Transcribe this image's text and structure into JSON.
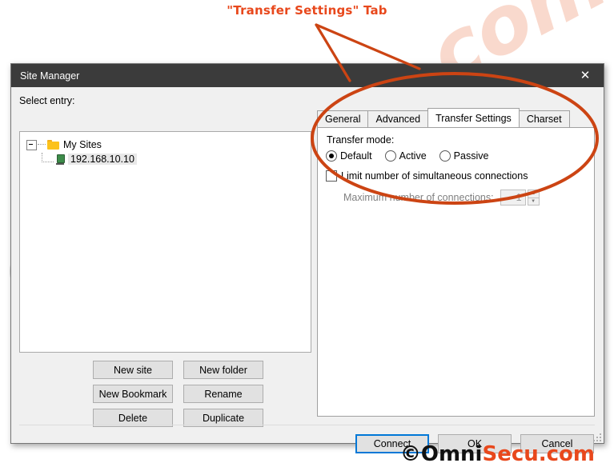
{
  "annotation": {
    "callout_text": "\"Transfer Settings\" Tab",
    "callout_color": "#e8481c",
    "ellipse_color": "#cc4413"
  },
  "watermark": {
    "part_gray": "Omni",
    "part_orange": "Secu.com"
  },
  "dialog": {
    "title": "Site Manager",
    "close_icon": "close-icon",
    "select_entry_label": "Select entry:",
    "tree": {
      "root": {
        "label": "My Sites",
        "icon": "folder-icon",
        "expander": "collapse-minus-icon"
      },
      "child": {
        "label": "192.168.10.10",
        "icon": "server-icon",
        "selected": true
      }
    },
    "left_buttons": [
      {
        "label": "New site"
      },
      {
        "label": "New folder"
      },
      {
        "label": "New Bookmark"
      },
      {
        "label": "Rename"
      },
      {
        "label": "Delete"
      },
      {
        "label": "Duplicate"
      }
    ],
    "tabs": [
      {
        "label": "General",
        "active": false
      },
      {
        "label": "Advanced",
        "active": false
      },
      {
        "label": "Transfer Settings",
        "active": true
      },
      {
        "label": "Charset",
        "active": false
      }
    ],
    "transfer_settings": {
      "transfer_mode_label": "Transfer mode:",
      "radios": [
        {
          "label": "Default",
          "checked": true
        },
        {
          "label": "Active",
          "checked": false
        },
        {
          "label": "Passive",
          "checked": false
        }
      ],
      "limit_checkbox": {
        "label": "Limit number of simultaneous connections",
        "checked": false
      },
      "max_connections": {
        "label": "Maximum number of connections:",
        "value": "1",
        "up_icon": "spinner-up-icon",
        "down_icon": "spinner-down-icon"
      }
    },
    "footer_buttons": [
      {
        "label": "Connect",
        "default": true
      },
      {
        "label": "OK",
        "default": false
      },
      {
        "label": "Cancel",
        "default": false
      }
    ]
  },
  "site_logo": {
    "prefix": "©Omni",
    "suffix": "Secu.com"
  }
}
